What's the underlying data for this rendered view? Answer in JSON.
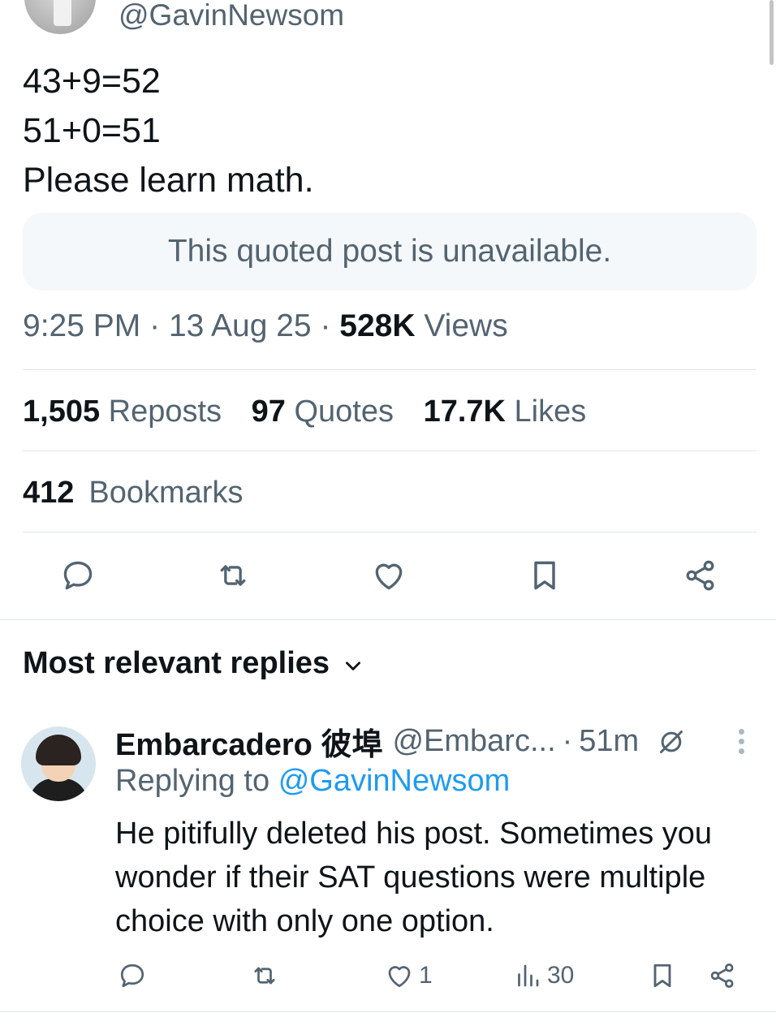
{
  "post": {
    "author_handle": "@GavinNewsom",
    "text_lines": [
      "43+9=52",
      "51+0=51",
      "Please learn math."
    ],
    "quoted_notice": "This quoted post is unavailable.",
    "time": "9:25 PM",
    "date": "13 Aug 25",
    "views_count": "528K",
    "views_label": "Views",
    "separator": "·"
  },
  "stats": {
    "reposts_count": "1,505",
    "reposts_label": "Reposts",
    "quotes_count": "97",
    "quotes_label": "Quotes",
    "likes_count": "17.7K",
    "likes_label": "Likes",
    "bookmarks_count": "412",
    "bookmarks_label": "Bookmarks"
  },
  "actions": {
    "icons": [
      "reply-icon",
      "repost-icon",
      "like-icon",
      "bookmark-icon",
      "share-icon"
    ]
  },
  "replies_sort": {
    "label": "Most relevant replies"
  },
  "reply": {
    "name": "Embarcadero 彼埠",
    "handle": "@Embarc...",
    "separator": "·",
    "time": "51m",
    "replying_prefix": "Replying to",
    "replying_mention": "@GavinNewsom",
    "text": "He pitifully deleted his post. Sometimes you wonder if their SAT questions were multiple choice with only one option.",
    "likes": "1",
    "views": "30"
  },
  "colors": {
    "text_primary": "#0f1419",
    "text_secondary": "#536471",
    "link": "#1d9bf0",
    "divider": "#e1e6ea"
  }
}
